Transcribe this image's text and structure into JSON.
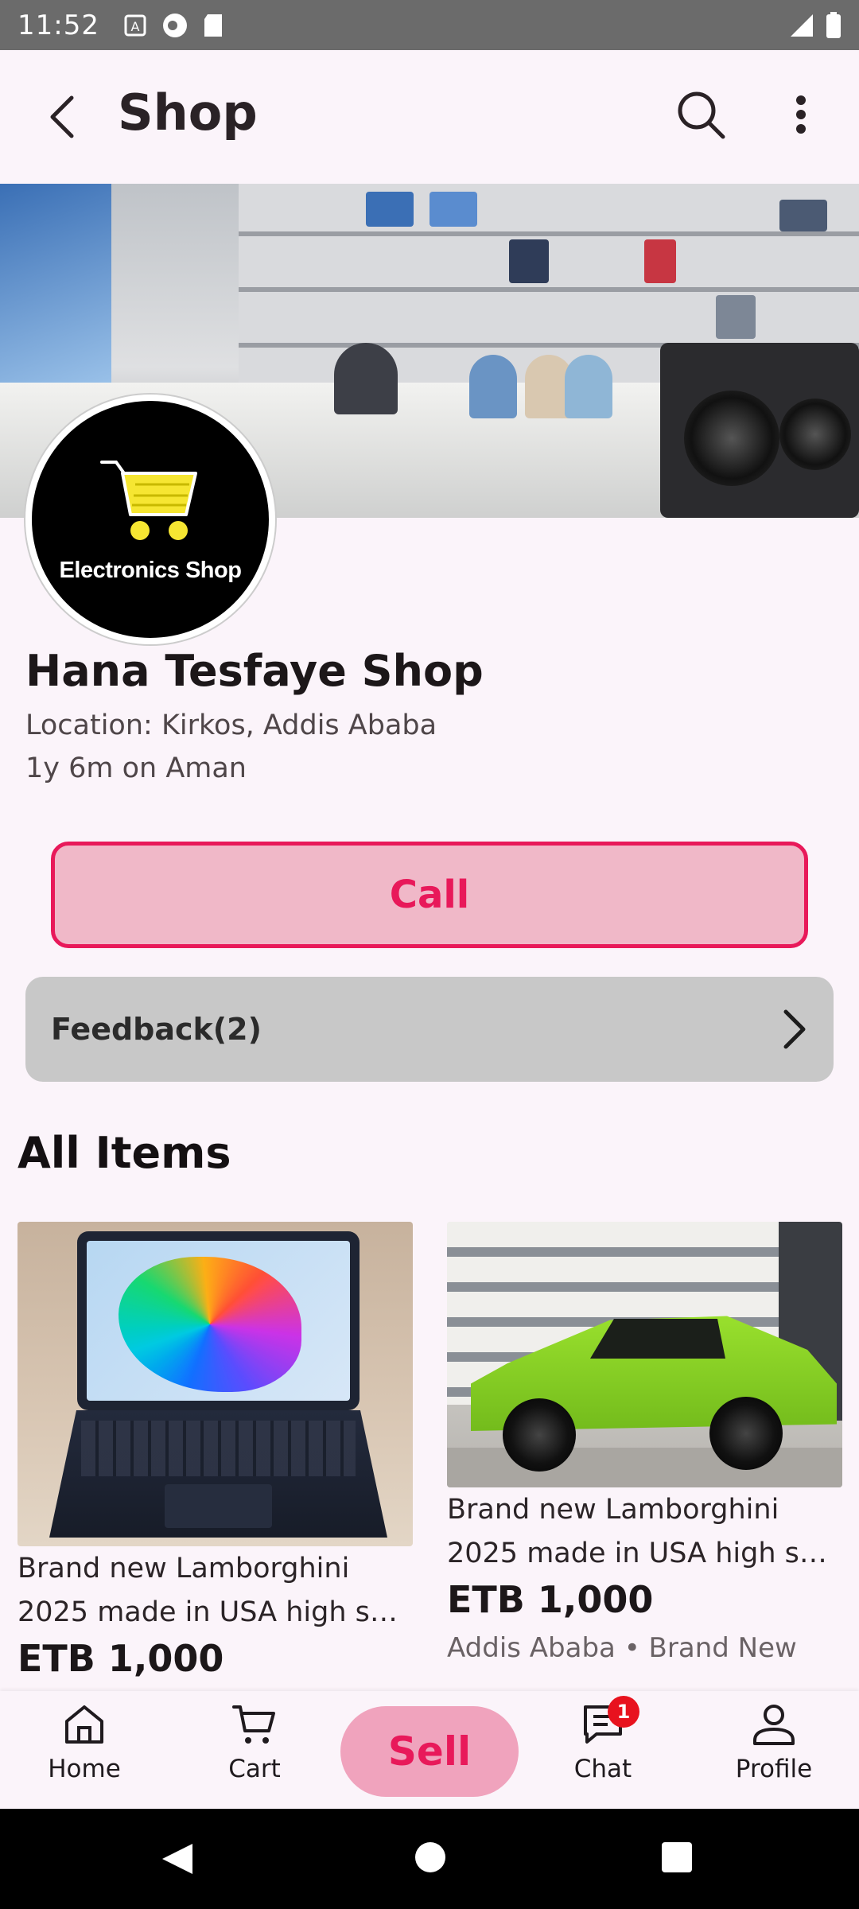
{
  "status_bar": {
    "time": "11:52"
  },
  "app_bar": {
    "title": "Shop"
  },
  "shop": {
    "logo_text": "Electronics Shop",
    "name": "Hana Tesfaye Shop",
    "location": "Location: Kirkos, Addis Ababa",
    "age": "1y 6m on Aman"
  },
  "actions": {
    "call_label": "Call",
    "feedback_label": "Feedback(2)"
  },
  "section": {
    "title": "All Items"
  },
  "items": [
    {
      "image_icon": "laptop-image",
      "title_line1": "Brand new Lamborghini",
      "title_line2": "2025 made in USA high spe...",
      "price": "ETB 1,000"
    },
    {
      "image_icon": "car-image",
      "title_line1": "Brand new Lamborghini",
      "title_line2": "2025 made in USA high spe...",
      "price": "ETB 1,000",
      "meta": "Addis Ababa • Brand New"
    }
  ],
  "bottom_nav": {
    "home": "Home",
    "cart": "Cart",
    "sell": "Sell",
    "chat": "Chat",
    "chat_badge": "1",
    "profile": "Profile"
  },
  "colors": {
    "accent": "#e8195a",
    "call_bg": "#f0b8c8",
    "sell_bg": "#f0a3bd",
    "feedback_bg": "#c8c8c8",
    "badge": "#e8121e"
  }
}
